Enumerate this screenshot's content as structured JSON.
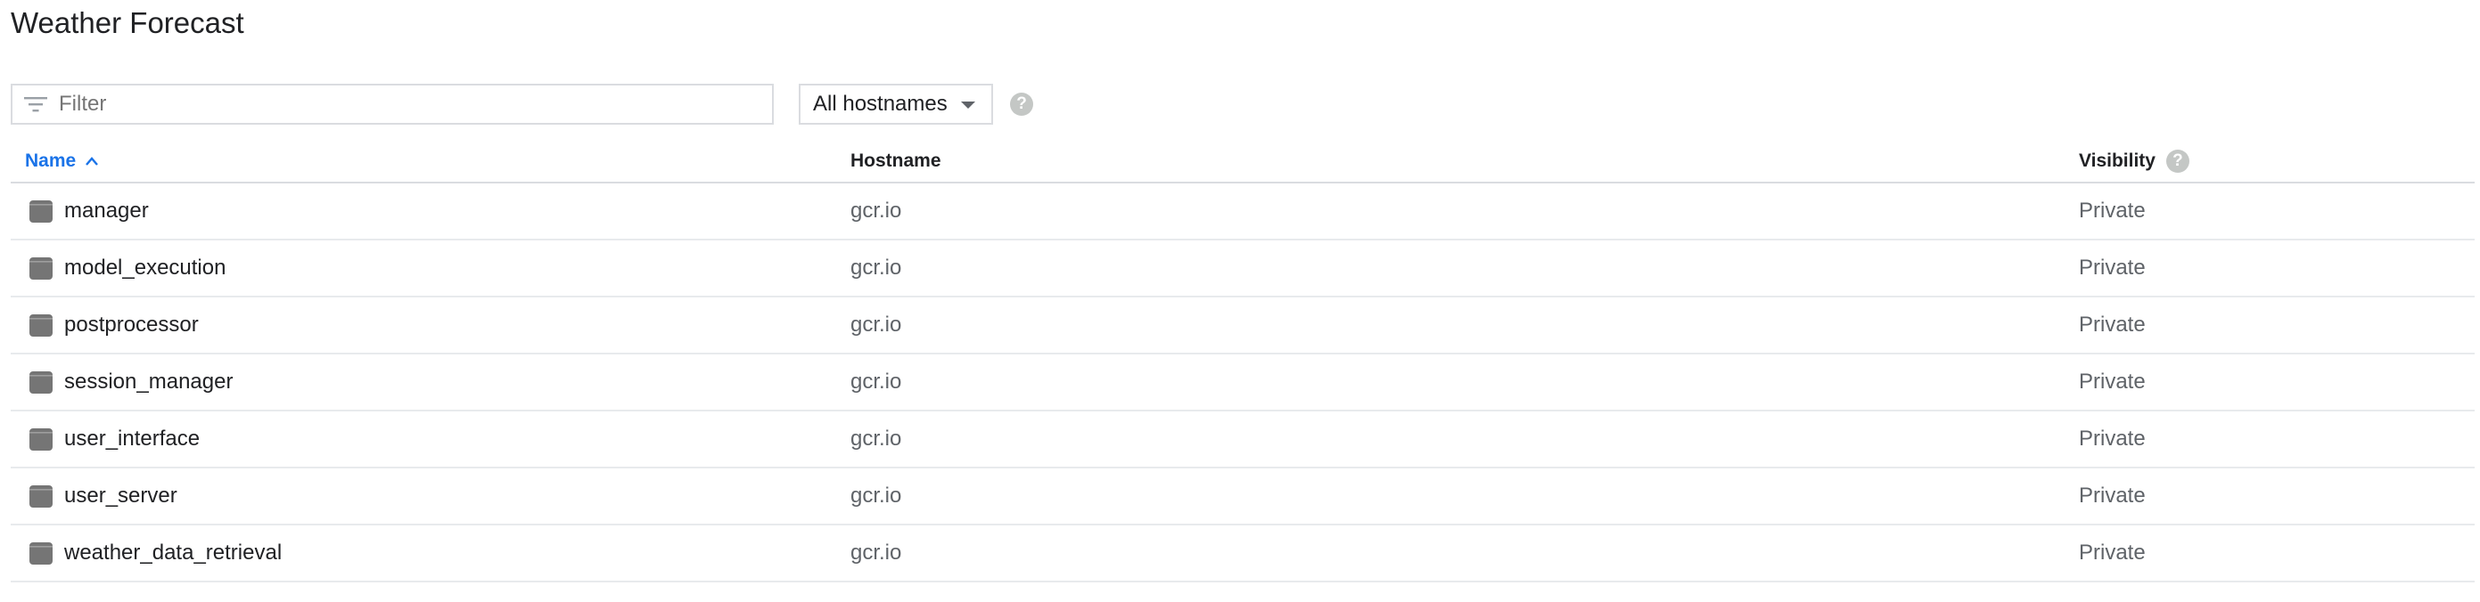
{
  "page": {
    "title": "Weather Forecast"
  },
  "toolbar": {
    "filter_placeholder": "Filter",
    "filter_value": "",
    "hostname_select_value": "All hostnames",
    "help_glyph": "?"
  },
  "table": {
    "columns": {
      "name": "Name",
      "hostname": "Hostname",
      "visibility": "Visibility"
    },
    "sort": {
      "column": "name",
      "direction": "ascending"
    },
    "rows": [
      {
        "name": "manager",
        "hostname": "gcr.io",
        "visibility": "Private"
      },
      {
        "name": "model_execution",
        "hostname": "gcr.io",
        "visibility": "Private"
      },
      {
        "name": "postprocessor",
        "hostname": "gcr.io",
        "visibility": "Private"
      },
      {
        "name": "session_manager",
        "hostname": "gcr.io",
        "visibility": "Private"
      },
      {
        "name": "user_interface",
        "hostname": "gcr.io",
        "visibility": "Private"
      },
      {
        "name": "user_server",
        "hostname": "gcr.io",
        "visibility": "Private"
      },
      {
        "name": "weather_data_retrieval",
        "hostname": "gcr.io",
        "visibility": "Private"
      }
    ]
  },
  "icons": {
    "filter": "filter-icon",
    "dropdown": "caret-down-icon",
    "help": "help-icon",
    "sort": "sort-ascending-icon",
    "repository": "repository-icon"
  },
  "colors": {
    "accent": "#1a73e8",
    "text": "#202124",
    "muted": "#5f6368",
    "border": "#dadce0",
    "repo_icon": "#757575",
    "help_icon": "#c4c7c5"
  }
}
